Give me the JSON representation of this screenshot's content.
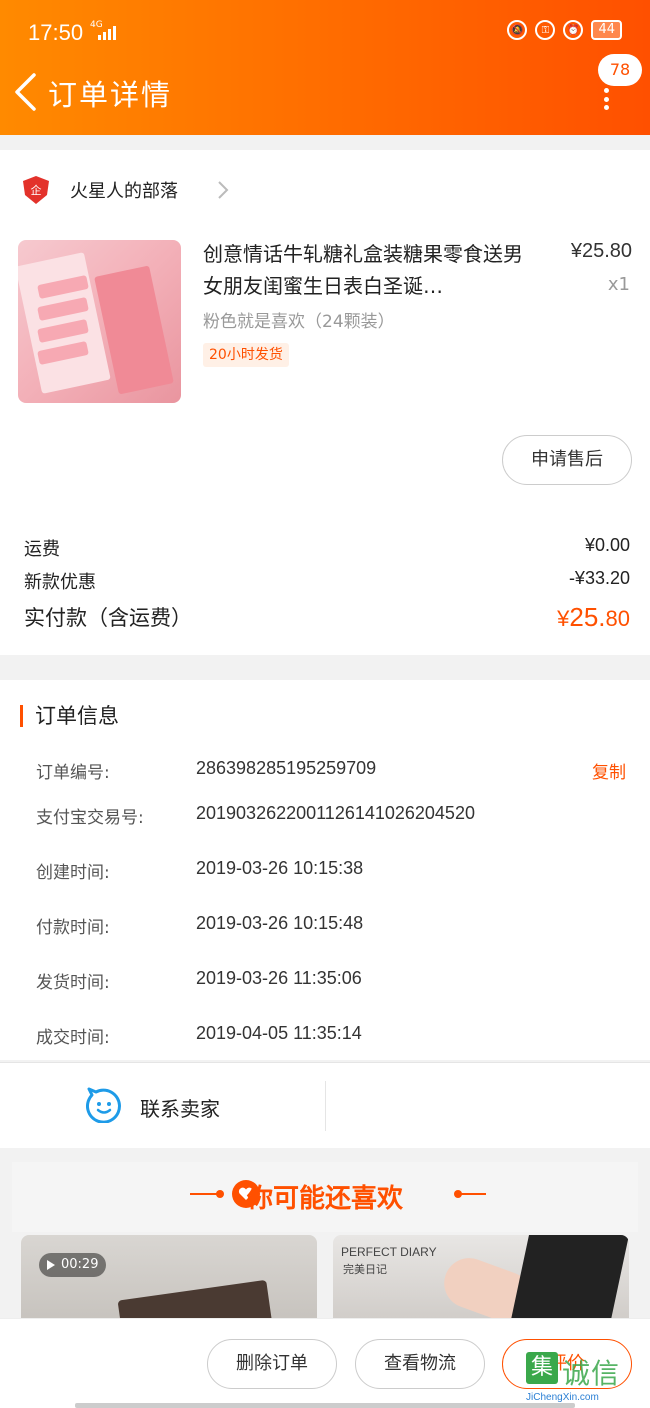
{
  "status_bar": {
    "time": "17:50",
    "network": "4G",
    "battery": "44"
  },
  "nav": {
    "title": "订单详情",
    "badge_count": "78"
  },
  "shop": {
    "name": "火星人的部落"
  },
  "product": {
    "title": "创意情话牛轧糖礼盒装糖果零食送男女朋友闺蜜生日表白圣诞…",
    "price": "¥25.80",
    "quantity": "x1",
    "spec": "粉色就是喜欢（24颗装）",
    "tag": "20小时发货",
    "aftersale_label": "申请售后"
  },
  "fees": {
    "shipping_label": "运费",
    "shipping_value": "¥0.00",
    "discount_label": "新款优惠",
    "discount_value": "-¥33.20",
    "total_label": "实付款（含运费）",
    "total_currency": "¥",
    "total_int": "25.",
    "total_dec": "80"
  },
  "order_info": {
    "section_title": "订单信息",
    "copy_label": "复制",
    "rows": [
      {
        "label": "订单编号:",
        "value": "286398285195259709"
      },
      {
        "label": "支付宝交易号:",
        "value": "2019032622001126141026204520"
      },
      {
        "label": "创建时间:",
        "value": "2019-03-26 10:15:38"
      },
      {
        "label": "付款时间:",
        "value": "2019-03-26 10:15:48"
      },
      {
        "label": "发货时间:",
        "value": "2019-03-26 11:35:06"
      },
      {
        "label": "成交时间:",
        "value": "2019-04-05 11:35:14"
      }
    ]
  },
  "contact": {
    "label": "联系卖家"
  },
  "recommend": {
    "title": "你可能还喜欢",
    "video_duration": "00:29",
    "brand_name": "PERFECT DIARY",
    "brand_sub": "完美日记"
  },
  "bottom_actions": {
    "delete_label": "删除订单",
    "logistics_label": "查看物流",
    "review_label": "评价"
  },
  "watermark": {
    "box_char": "集",
    "text": "诚信",
    "url": "JiChengXin.com"
  },
  "colors": {
    "brand_orange": "#ff5000",
    "header_start": "#ff8a00"
  }
}
